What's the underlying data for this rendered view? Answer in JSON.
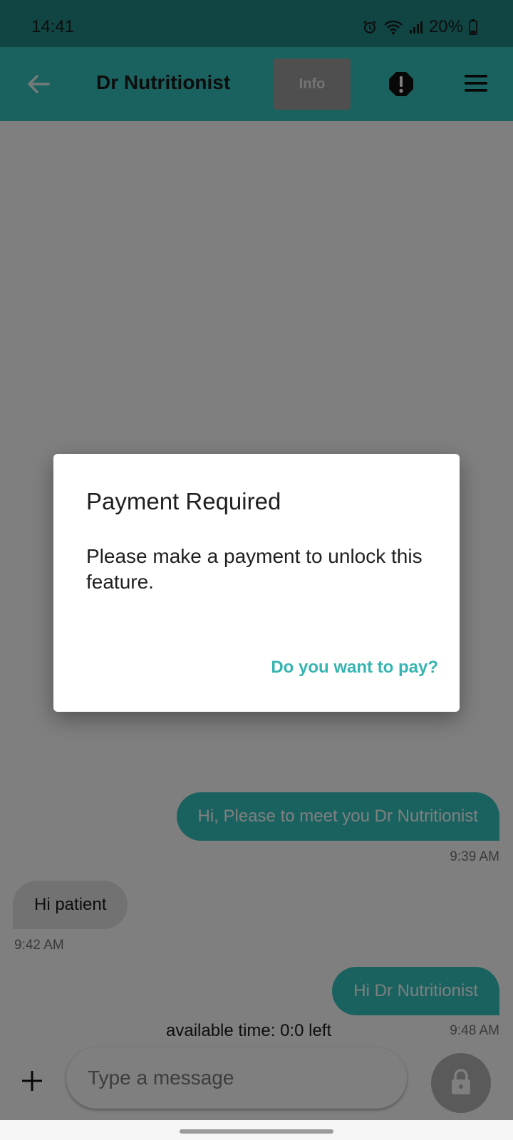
{
  "status_bar": {
    "time": "14:41",
    "battery": "20%"
  },
  "app_bar": {
    "title": "Dr Nutritionist",
    "info_label": "Info"
  },
  "messages": [
    {
      "text": "Hi, Please to meet you Dr Nutritionist",
      "time": "9:39 AM",
      "direction": "outgoing"
    },
    {
      "text": "Hi patient",
      "time": "9:42 AM",
      "direction": "incoming"
    },
    {
      "text": "Hi Dr Nutritionist",
      "time": "9:48 AM",
      "direction": "outgoing"
    }
  ],
  "available_time": "available time: 0:0 left",
  "composer": {
    "placeholder": "Type a message"
  },
  "dialog": {
    "title": "Payment Required",
    "message": "Please make a payment to unlock this feature.",
    "action_label": "Do you want to pay?"
  },
  "colors": {
    "accent": "#35c4bf",
    "status_bar": "#208b86",
    "dialog_action": "#35b5b0"
  },
  "icons": {
    "back": "arrow-left-icon",
    "alert": "alert-octagon-icon",
    "menu": "hamburger-menu-icon",
    "add": "plus-icon",
    "send_locked": "lock-icon"
  }
}
